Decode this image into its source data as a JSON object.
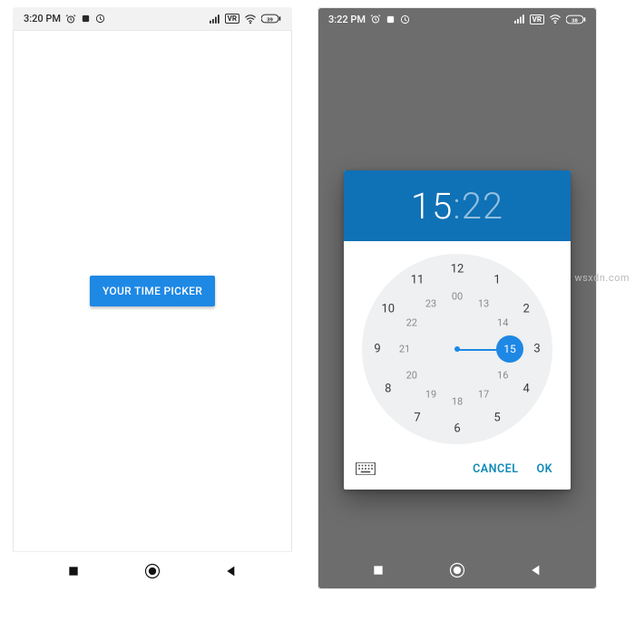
{
  "watermark": "wsxdn.com",
  "left": {
    "status": {
      "time": "3:20 PM"
    },
    "button": {
      "label": "YOUR TIME PICKER"
    }
  },
  "right": {
    "status": {
      "time": "3:22 PM"
    },
    "dialog": {
      "hour": "15",
      "sep": ":",
      "minute": "22",
      "selected_inner_hour": "15",
      "outer_labels": [
        "12",
        "1",
        "2",
        "3",
        "4",
        "5",
        "6",
        "7",
        "8",
        "9",
        "10",
        "11"
      ],
      "inner_labels": [
        "00",
        "13",
        "14",
        "15",
        "16",
        "17",
        "18",
        "19",
        "20",
        "21",
        "22",
        "23"
      ],
      "actions": {
        "cancel": "CANCEL",
        "ok": "OK"
      }
    }
  },
  "colors": {
    "primary": "#1e88e5",
    "header": "#0f71b6",
    "action": "#0f8ab5"
  }
}
